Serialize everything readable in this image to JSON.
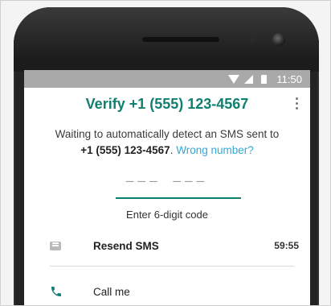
{
  "status_bar": {
    "time": "11:50",
    "icons": [
      "wifi-icon",
      "signal-icon",
      "battery-icon"
    ]
  },
  "header": {
    "title": "Verify +1 (555) 123-4567",
    "menu_icon": "more-vert-icon"
  },
  "message": {
    "line1": "Waiting to automatically detect an SMS sent to",
    "phone": "+1 (555) 123-4567",
    "punct": ".",
    "wrong_number_link": "Wrong number?"
  },
  "code_input": {
    "placeholder": "––– –––",
    "caption": "Enter 6-digit code"
  },
  "options": {
    "resend_sms": {
      "label": "Resend SMS",
      "timer": "59:55",
      "icon": "message-icon"
    },
    "call_me": {
      "label": "Call me",
      "icon": "phone-icon"
    }
  },
  "colors": {
    "accent": "#0F7F6F",
    "link": "#34A7D6",
    "status_bar": "#A9A9A9"
  }
}
